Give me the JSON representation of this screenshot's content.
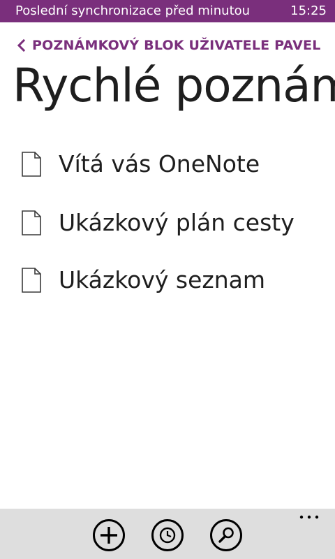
{
  "status_bar": {
    "text": "Poslední synchronizace před minutou",
    "time": "15:25"
  },
  "breadcrumb": {
    "label": "POZNÁMKOVÝ BLOK UŽIVATELE PAVEL",
    "icon": "chevron-left-icon"
  },
  "page": {
    "title": "Rychlé poznámky"
  },
  "notes": [
    {
      "label": "Vítá vás OneNote",
      "icon": "page-icon"
    },
    {
      "label": "Ukázkový plán cesty",
      "icon": "page-icon"
    },
    {
      "label": "Ukázkový seznam",
      "icon": "page-icon"
    }
  ],
  "app_bar": {
    "buttons": [
      {
        "icon": "add-icon"
      },
      {
        "icon": "recent-clock-icon"
      },
      {
        "icon": "search-icon"
      }
    ],
    "more_icon": "ellipsis-icon"
  },
  "colors": {
    "accent": "#7a2f7c",
    "app_bar_bg": "#dedede",
    "text": "#1e1e1e"
  }
}
